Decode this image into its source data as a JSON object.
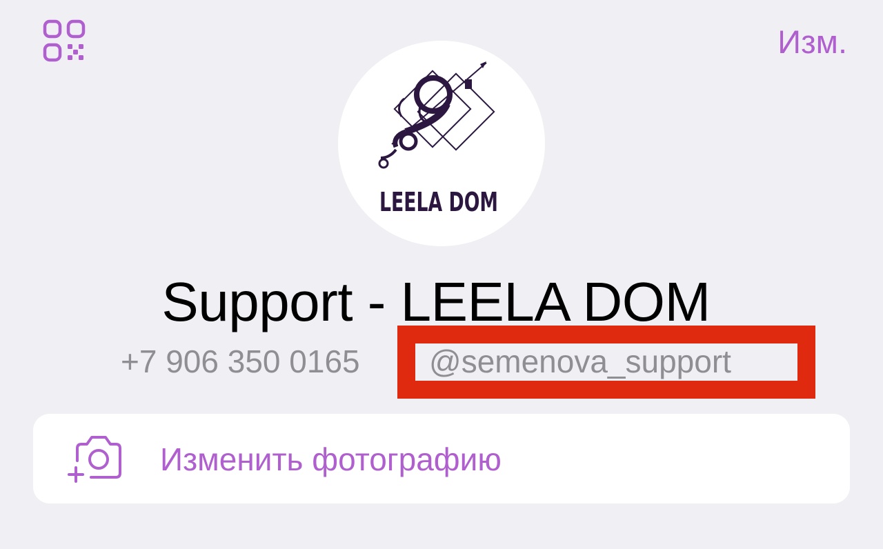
{
  "header": {
    "qr_icon": "qr-code-icon",
    "edit_label": "Изм."
  },
  "avatar": {
    "logo_text": "LEELA DOM"
  },
  "profile": {
    "name": "Support - LEELA DOM",
    "phone": "+7 906 350 0165",
    "username": "@semenova_support"
  },
  "actions": {
    "change_photo_icon": "camera-add-icon",
    "change_photo_label": "Изменить фотографию"
  },
  "colors": {
    "accent": "#b05fcf",
    "background": "#efeff4",
    "secondary_text": "#8e8e93",
    "highlight": "#e02a10",
    "logo": "#2b1740"
  }
}
